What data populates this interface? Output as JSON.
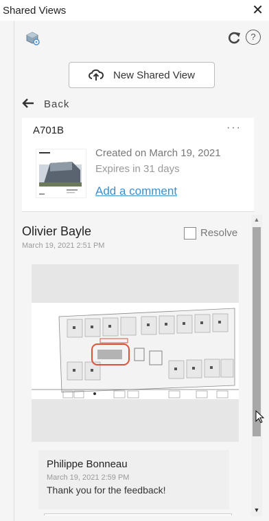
{
  "titlebar": {
    "title": "Shared Views",
    "close": "✕"
  },
  "toolbar": {
    "left_icon": "shared-views-cube-icon",
    "refresh_icon": "refresh-icon",
    "help_label": "?"
  },
  "new_view_button": {
    "label": "New Shared View",
    "icon": "cloud-upload-icon"
  },
  "back": {
    "label": "Back",
    "arrow": "🡐"
  },
  "view": {
    "name": "A701B",
    "more": "···",
    "created": "Created on March 19, 2021",
    "expires": "Expires in 31 days",
    "add_comment": "Add a comment"
  },
  "comments": [
    {
      "author": "Olivier Bayle",
      "timestamp": "March 19, 2021 2:51 PM",
      "resolve_label": "Resolve",
      "resolved": false,
      "replies": [
        {
          "author": "Philippe Bonneau",
          "timestamp": "March 19, 2021 2:59 PM",
          "text": "Thank you for the feedback!"
        }
      ]
    }
  ],
  "colors": {
    "link": "#3b8fd0",
    "markup": "#d9533a",
    "panel": "#f5f5f5"
  },
  "scroll": {
    "up": "▲",
    "down": "▼"
  }
}
